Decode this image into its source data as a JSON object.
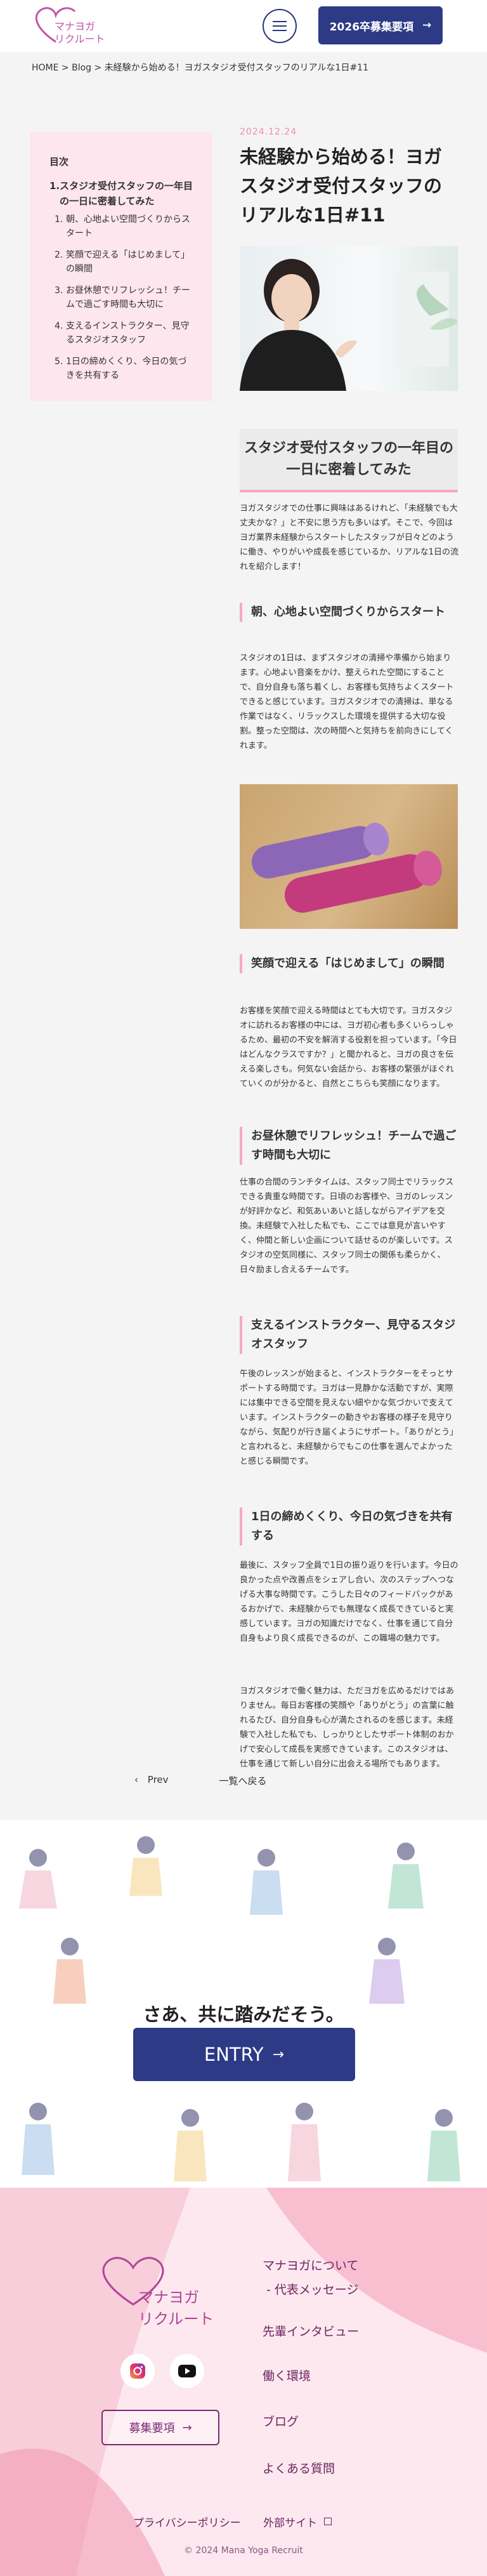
{
  "header": {
    "logo_text_line1": "マナヨガ",
    "logo_text_line2": "リクルート",
    "recruit_label": "2026卒募集要項",
    "recruit_arrow": "→"
  },
  "breadcrumb": "HOME > Blog > 未経験から始める！ヨガスタジオ受付スタッフのリアルな1日#11",
  "toc": {
    "title": "目次",
    "main": {
      "num": "1.",
      "label": "スタジオ受付スタッフの一年目の一日に密着してみた"
    },
    "items": [
      {
        "num": "1.",
        "label": "朝、心地よい空間づくりからスタート"
      },
      {
        "num": "2.",
        "label": "笑顔で迎える「はじめまして」の瞬間"
      },
      {
        "num": "3.",
        "label": "お昼休憩でリフレッシュ！チームで過ごす時間も大切に"
      },
      {
        "num": "4.",
        "label": "支えるインストラクター、見守るスタジオスタッフ"
      },
      {
        "num": "5.",
        "label": "1日の締めくくり、今日の気づきを共有する"
      }
    ]
  },
  "article": {
    "date": "2024.12.24",
    "title": "未経験から始める！ヨガスタジオ受付スタッフのリアルな1日#11",
    "section_title": "スタジオ受付スタッフの一年目の一日に密着してみた",
    "intro": "ヨガスタジオでの仕事に興味はあるけれど、「未経験でも大丈夫かな？」と不安に思う方も多いはず。そこで、今回はヨガ業界未経験からスタートしたスタッフが日々どのように働き、やりがいや成長を感じているか、リアルな1日の流れを紹介します！",
    "h3_1": "朝、心地よい空間づくりからスタート",
    "p1": "スタジオの1日は、まずスタジオの清掃や準備から始まります。心地よい音楽をかけ、整えられた空間にすることで、自分自身も落ち着くし、お客様も気持ちよくスタートできると感じています。ヨガスタジオでの清掃は、単なる作業ではなく、リラックスした環境を提供する大切な役割。整った空間は、次の時間へと気持ちを前向きにしてくれます。",
    "h3_2": "笑顔で迎える「はじめまして」の瞬間",
    "p2": "お客様を笑顔で迎える時間はとても大切です。ヨガスタジオに訪れるお客様の中には、ヨガ初心者も多くいらっしゃるため、最初の不安を解消する役割を担っています。「今日はどんなクラスですか？」と聞かれると、ヨガの良さを伝える楽しさも。何気ない会話から、お客様の緊張がほぐれていくのが分かると、自然とこちらも笑顔になります。",
    "h3_3": "お昼休憩でリフレッシュ！チームで過ごす時間も大切に",
    "p3": "仕事の合間のランチタイムは、スタッフ同士でリラックスできる貴重な時間です。日頃のお客様や、ヨガのレッスンが好評かなど、和気あいあいと話しながらアイデアを交換。未経験で入社した私でも、ここでは意見が言いやすく、仲間と新しい企画について話せるのが楽しいです。スタジオの空気同様に、スタッフ同士の関係も柔らかく、日々励まし合えるチームです。",
    "h3_4": "支えるインストラクター、見守るスタジオスタッフ",
    "p4": "午後のレッスンが始まると、インストラクターをそっとサポートする時間です。ヨガは一見静かな活動ですが、実際には集中できる空間を見えない細やかな気づかいで支えています。インストラクターの動きやお客様の様子を見守りながら、気配りが行き届くようにサポート。「ありがとう」と言われると、未経験からでもこの仕事を選んでよかったと感じる瞬間です。",
    "h3_5": "1日の締めくくり、今日の気づきを共有する",
    "p5": "最後に、スタッフ全員で1日の振り返りを行います。今日の良かった点や改善点をシェアし合い、次のステップへつなげる大事な時間です。こうした日々のフィードバックがあるおかげで、未経験からでも無理なく成長できていると実感しています。ヨガの知識だけでなく、仕事を通じて自分自身もより良く成長できるのが、この職場の魅力です。",
    "p6": "ヨガスタジオで働く魅力は、ただヨガを広めるだけではありません。毎日お客様の笑顔や「ありがとう」の言葉に触れるたび、自分自身も心が満たされるのを感じます。未経験で入社した私でも、しっかりとしたサポート体制のおかげで安心して成長を実感できています。このスタジオは、仕事を通じて新しい自分に出会える場所でもあります。"
  },
  "pager": {
    "prev": "Prev",
    "prev_icon": "‹",
    "list": "一覧へ戻る"
  },
  "entry": {
    "text": "さあ、共に踏みだそう。",
    "button": "ENTRY",
    "arrow": "→"
  },
  "footer": {
    "logo_line1": "マナヨガ",
    "logo_line2": "リクルート",
    "recruit_label": "募集要項",
    "recruit_arrow": "→",
    "nav": [
      "マナヨガについて",
      "- 代表メッセージ",
      "先輩インタビュー",
      "働く環境",
      "ブログ",
      "よくある質問"
    ],
    "privacy": "プライバシーポリシー",
    "external": "外部サイト",
    "copyright": "© 2024 Mana Yoga Recruit"
  },
  "colors": {
    "navy": "#2d3a86",
    "pink": "#f8a8bf",
    "purple": "#c255a6"
  }
}
